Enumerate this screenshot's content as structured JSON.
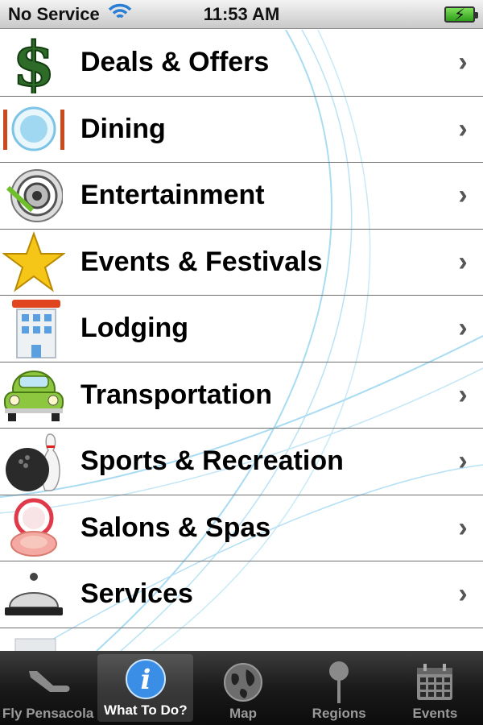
{
  "status_bar": {
    "carrier": "No Service",
    "time": "11:53 AM",
    "battery_icon": "battery-charging-icon",
    "wifi_icon": "wifi-icon"
  },
  "list": {
    "items": [
      {
        "label": "Deals & Offers",
        "icon": "dollar-icon"
      },
      {
        "label": "Dining",
        "icon": "plate-icon"
      },
      {
        "label": "Entertainment",
        "icon": "target-icon"
      },
      {
        "label": "Events & Festivals",
        "icon": "star-icon"
      },
      {
        "label": "Lodging",
        "icon": "hotel-icon"
      },
      {
        "label": "Transportation",
        "icon": "car-icon"
      },
      {
        "label": "Sports & Recreation",
        "icon": "bowling-icon"
      },
      {
        "label": "Salons & Spas",
        "icon": "compact-icon"
      },
      {
        "label": "Services",
        "icon": "bell-icon"
      }
    ]
  },
  "tab_bar": {
    "tabs": [
      {
        "label": "Fly Pensacola",
        "icon": "airplane-icon",
        "active": false
      },
      {
        "label": "What To Do?",
        "icon": "info-icon",
        "active": true
      },
      {
        "label": "Map",
        "icon": "globe-icon",
        "active": false
      },
      {
        "label": "Regions",
        "icon": "pin-icon",
        "active": false
      },
      {
        "label": "Events",
        "icon": "calendar-icon",
        "active": false
      }
    ]
  },
  "colors": {
    "active_tab_icon": "#3a8ee6",
    "swirl": "#9fd3ee"
  }
}
